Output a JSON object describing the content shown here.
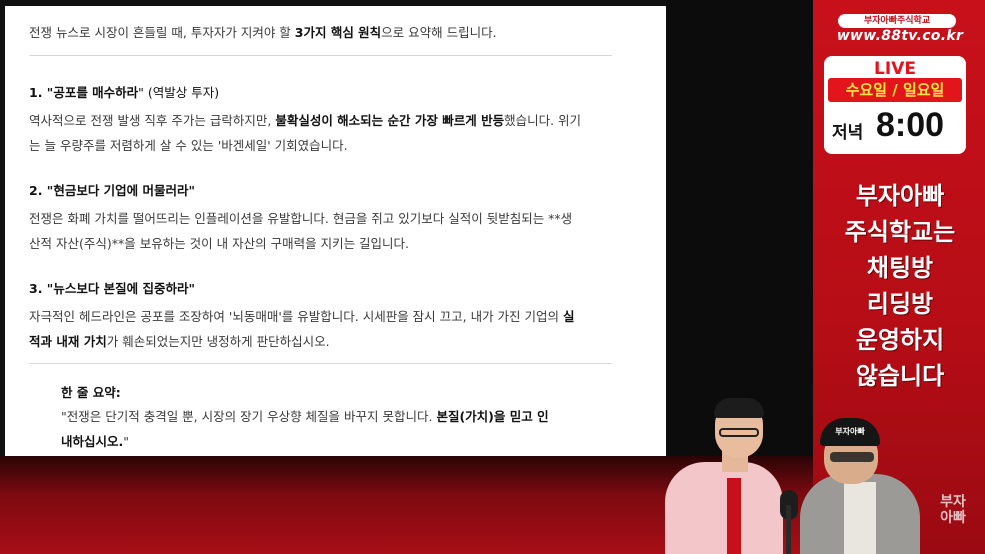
{
  "document": {
    "intro": [
      "전쟁 뉴스로 시장이 흔들릴 때, 투자자가 지켜야 할 ",
      "3가지 핵심 원칙",
      "으로 요약해 드립니다."
    ],
    "principle1": {
      "title": [
        "1. \"",
        "공포를 매수하라",
        "\" (역발상 투자)"
      ],
      "line1": [
        "역사적으로 전쟁 발생 직후 주가는 급락하지만, ",
        "불확실성이 해소되는 순간 가장 빠르게 반등",
        "했습니다. 위기"
      ],
      "line2": "는 늘 우량주를 저렴하게 살 수 있는 '바겐세일' 기회였습니다."
    },
    "principle2": {
      "title": [
        "2. \"",
        "현금보다 기업에 머물러라",
        "\""
      ],
      "line1": "전쟁은 화폐 가치를 떨어뜨리는 인플레이션을 유발합니다. 현금을 쥐고 있기보다 실적이 뒷받침되는 **생",
      "line2": "산적 자산(주식)**을 보유하는 것이 내 자산의 구매력을 지키는 길입니다."
    },
    "principle3": {
      "title": [
        "3. \"",
        "뉴스보다 본질에 집중하라",
        "\""
      ],
      "line1": [
        "자극적인 헤드라인은 공포를 조장하여 '뇌동매매'를 유발합니다. 시세판을 잠시 끄고, 내가 가진 기업의 ",
        "실"
      ],
      "line2": [
        "적과 내재 가치",
        "가 훼손되었는지만 냉정하게 판단하십시오."
      ]
    },
    "summary": {
      "heading": "한 줄 요약:",
      "line1": [
        "\"전쟁은 단기적 충격일 뿐, 시장의 장기 우상향 체질을 바꾸지 못합니다. ",
        "본질(가치)을 믿고 인"
      ],
      "line2": [
        "내하십시오.",
        "\""
      ]
    }
  },
  "banner": {
    "logo_small": "부자아빠주식학교",
    "site_url": "www.88tv.co.kr",
    "live_label": "LIVE",
    "days": "수요일 / 일요일",
    "time_label": "저녁",
    "time_value": "8:00",
    "notice_lines": [
      "부자아빠",
      "주식학교는",
      "채팅방",
      "리딩방",
      "운영하지",
      "않습니다"
    ],
    "corner_logo": [
      "부자",
      "아빠"
    ]
  },
  "presenters": {
    "cap_text": "부자아빠"
  },
  "colors": {
    "brand_red": "#c8101a",
    "accent_yellow": "#ffe840"
  }
}
